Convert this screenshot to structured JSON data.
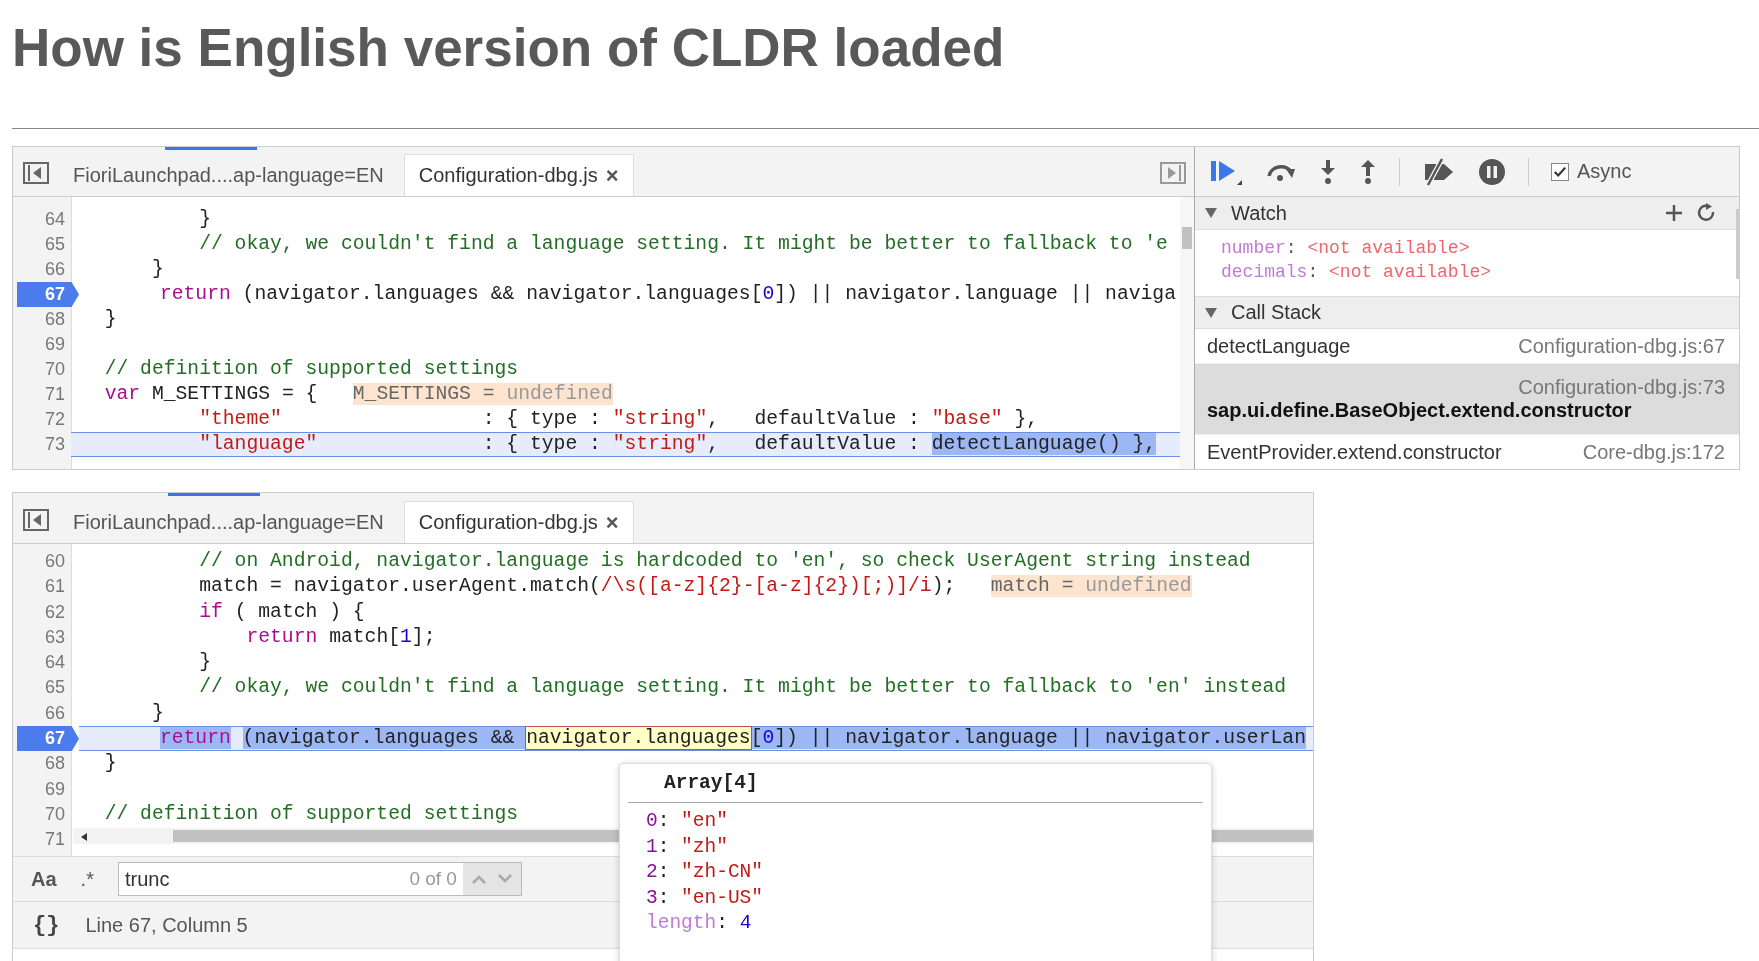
{
  "slide_title": "How is English version of CLDR loaded",
  "top_panel": {
    "tabs": [
      {
        "label": "FioriLaunchpad....ap-language=EN",
        "selected": false
      },
      {
        "label": "Configuration-dbg.js",
        "selected": true,
        "close": "×"
      }
    ],
    "lines": [
      {
        "num": "64",
        "breakpoint": false,
        "current": false,
        "tokens": [
          {
            "kind": "plain",
            "text": "          }"
          }
        ]
      },
      {
        "num": "65",
        "breakpoint": false,
        "current": false,
        "tokens": [
          {
            "kind": "comment",
            "text": "          // okay, we couldn't find a language setting. It might be better to fallback to 'e"
          }
        ]
      },
      {
        "num": "66",
        "breakpoint": false,
        "current": false,
        "tokens": [
          {
            "kind": "plain",
            "text": "      }"
          }
        ]
      },
      {
        "num": "67",
        "breakpoint": true,
        "current": false,
        "tokens": [
          {
            "kind": "keyword",
            "text": "      return"
          },
          {
            "kind": "plain",
            "text": " (navigator.languages && navigator.languages["
          },
          {
            "kind": "number",
            "text": "0"
          },
          {
            "kind": "plain",
            "text": "]) || navigator.language || naviga"
          }
        ]
      },
      {
        "num": "68",
        "breakpoint": false,
        "current": false,
        "tokens": [
          {
            "kind": "plain",
            "text": "  }"
          }
        ]
      },
      {
        "num": "69",
        "breakpoint": false,
        "current": false
      },
      {
        "num": "70",
        "breakpoint": false,
        "current": false,
        "tokens": [
          {
            "kind": "comment",
            "text": "  // definition of supported settings"
          }
        ]
      },
      {
        "num": "71",
        "breakpoint": false,
        "current": false,
        "tokens": [
          {
            "kind": "keyword",
            "text": "  var"
          },
          {
            "kind": "plain",
            "text": " M_SETTINGS = {  "
          },
          {
            "kind": "hint-name",
            "text": " M_SETTINGS = "
          },
          {
            "kind": "hint-value",
            "text": "undefined"
          }
        ]
      },
      {
        "num": "72",
        "breakpoint": false,
        "current": false,
        "tokens": [
          {
            "kind": "string",
            "text": "          \"theme\""
          },
          {
            "kind": "plain",
            "text": "                 : { type : "
          },
          {
            "kind": "string",
            "text": "\"string\""
          },
          {
            "kind": "plain",
            "text": ",   defaultValue : "
          },
          {
            "kind": "string",
            "text": "\"base\""
          },
          {
            "kind": "plain",
            "text": " },"
          }
        ]
      },
      {
        "num": "73",
        "breakpoint": false,
        "current": true,
        "tokens": [
          {
            "kind": "string",
            "text": "          \"language\"",
            "selected": false
          },
          {
            "kind": "plain",
            "text": "              : { type : ",
            "selected": false
          },
          {
            "kind": "string",
            "text": "\"string\"",
            "selected": false
          },
          {
            "kind": "plain",
            "text": ",   defaultValue : ",
            "selected": false
          },
          {
            "kind": "plain",
            "text": "detectLanguage() },",
            "selected": true
          }
        ]
      }
    ]
  },
  "debugger": {
    "async": {
      "label": "Async",
      "checked": true
    },
    "watch": {
      "title": "Watch",
      "expanded": true,
      "items": [
        {
          "name": "number",
          "separator": ": ",
          "value": "<not available>"
        },
        {
          "name": "decimals",
          "separator": ": ",
          "value": "<not available>"
        }
      ]
    },
    "call_stack": {
      "title": "Call Stack",
      "expanded": true,
      "frames": [
        {
          "function": "detectLanguage",
          "location": "Configuration-dbg.js:67",
          "selected": false
        },
        {
          "function": "sap.ui.define.BaseObject.extend.constructor",
          "location": "Configuration-dbg.js:73",
          "selected": true
        },
        {
          "function": "EventProvider.extend.constructor",
          "location": "Core-dbg.js:172",
          "selected": false
        }
      ]
    }
  },
  "bottom_panel": {
    "tabs": [
      {
        "label": "FioriLaunchpad....ap-language=EN",
        "selected": false
      },
      {
        "label": "Configuration-dbg.js",
        "selected": true,
        "close": "×"
      }
    ],
    "lines": [
      {
        "num": "60",
        "breakpoint": false,
        "current": false,
        "tokens": [
          {
            "kind": "comment",
            "text": "          // on Android, navigator.language is hardcoded to 'en', so check UserAgent string instead"
          }
        ]
      },
      {
        "num": "61",
        "breakpoint": false,
        "current": false,
        "tokens": [
          {
            "kind": "plain",
            "text": "          match = navigator.userAgent.match("
          },
          {
            "kind": "string",
            "text": "/\\s([a-z]{2}-[a-z]{2})[;)]/i"
          },
          {
            "kind": "plain",
            "text": ");  "
          },
          {
            "kind": "hint-name",
            "text": " match = "
          },
          {
            "kind": "hint-value",
            "text": "undefined"
          }
        ]
      },
      {
        "num": "62",
        "breakpoint": false,
        "current": false,
        "tokens": [
          {
            "kind": "keyword",
            "text": "          if"
          },
          {
            "kind": "plain",
            "text": " ( match ) {"
          }
        ]
      },
      {
        "num": "63",
        "breakpoint": false,
        "current": false,
        "tokens": [
          {
            "kind": "keyword",
            "text": "              return"
          },
          {
            "kind": "plain",
            "text": " match["
          },
          {
            "kind": "number",
            "text": "1"
          },
          {
            "kind": "plain",
            "text": "];"
          }
        ]
      },
      {
        "num": "64",
        "breakpoint": false,
        "current": false,
        "tokens": [
          {
            "kind": "plain",
            "text": "          }"
          }
        ]
      },
      {
        "num": "65",
        "breakpoint": false,
        "current": false,
        "tokens": [
          {
            "kind": "comment",
            "text": "          // okay, we couldn't find a language setting. It might be better to fallback to 'en' instead"
          }
        ]
      },
      {
        "num": "66",
        "breakpoint": false,
        "current": false,
        "tokens": [
          {
            "kind": "plain",
            "text": "      }"
          }
        ]
      },
      {
        "num": "67",
        "breakpoint": true,
        "current": true,
        "tokens": [
          {
            "kind": "keyword",
            "text": "      return",
            "selected": true,
            "hovered": false
          },
          {
            "kind": "plain",
            "text": " (navigator.languages && ",
            "selected": true,
            "hovered": false
          },
          {
            "kind": "plain",
            "text": "navigator.languages",
            "selected": false,
            "hovered": true
          },
          {
            "kind": "plain",
            "text": "[",
            "selected": true,
            "hovered": false
          },
          {
            "kind": "number",
            "text": "0",
            "selected": true,
            "hovered": false
          },
          {
            "kind": "plain",
            "text": "]) || navigator.language || navigator.userLan",
            "selected": true,
            "hovered": false
          }
        ]
      },
      {
        "num": "68",
        "breakpoint": false,
        "current": false,
        "tokens": [
          {
            "kind": "plain",
            "text": "  }"
          }
        ]
      },
      {
        "num": "69",
        "breakpoint": false,
        "current": false
      },
      {
        "num": "70",
        "breakpoint": false,
        "current": false,
        "tokens": [
          {
            "kind": "comment",
            "text": "  // definition of supported settings"
          }
        ]
      },
      {
        "num": "71",
        "breakpoint": false,
        "current": false
      }
    ],
    "search": {
      "case_label": "Aa",
      "regex_label": ".*",
      "value": "trunc",
      "count": "0 of 0"
    },
    "status": {
      "format_label": "{}",
      "position": "Line 67, Column 5"
    },
    "popover": {
      "title": "Array[4]",
      "entries": [
        {
          "kind": "index",
          "key": "0",
          "separator": ": ",
          "value": "\"en\""
        },
        {
          "kind": "index",
          "key": "1",
          "separator": ": ",
          "value": "\"zh\""
        },
        {
          "kind": "index",
          "key": "2",
          "separator": ": ",
          "value": "\"zh-CN\""
        },
        {
          "kind": "index",
          "key": "3",
          "separator": ": ",
          "value": "\"en-US\""
        },
        {
          "kind": "property",
          "key": "length",
          "separator": ": ",
          "value": "4"
        }
      ]
    }
  }
}
